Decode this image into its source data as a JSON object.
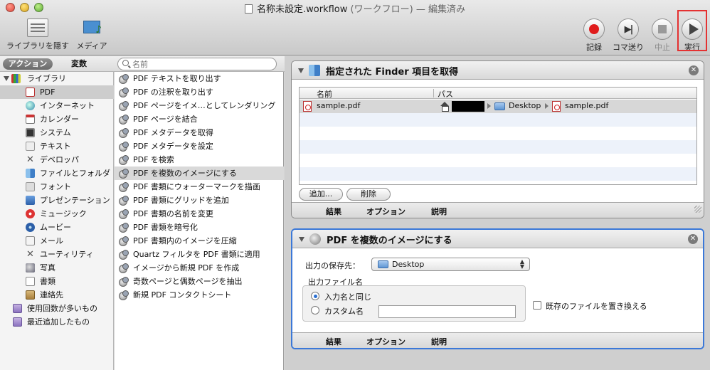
{
  "window": {
    "title": "名称未設定.workflow",
    "subtitle": "(ワークフロー) — 編集済み"
  },
  "toolbar": {
    "hide_library": "ライブラリを隠す",
    "media": "メディア",
    "record": "記録",
    "step": "コマ送り",
    "stop": "中止",
    "run": "実行"
  },
  "library_header": {
    "actions_tab": "アクション",
    "variables_tab": "変数",
    "search_placeholder": "名前"
  },
  "categories": [
    {
      "label": "ライブラリ",
      "icon": "library-icon"
    },
    {
      "label": "PDF",
      "icon": "pdf-icon",
      "selected": true
    },
    {
      "label": "インターネット",
      "icon": "globe-icon"
    },
    {
      "label": "カレンダー",
      "icon": "calendar-icon"
    },
    {
      "label": "システム",
      "icon": "system-icon"
    },
    {
      "label": "テキスト",
      "icon": "text-icon"
    },
    {
      "label": "デベロッパ",
      "icon": "developer-icon"
    },
    {
      "label": "ファイルとフォルダ",
      "icon": "finder-icon"
    },
    {
      "label": "フォント",
      "icon": "font-icon"
    },
    {
      "label": "プレゼンテーション",
      "icon": "presentation-icon"
    },
    {
      "label": "ミュージック",
      "icon": "music-icon"
    },
    {
      "label": "ムービー",
      "icon": "movie-icon"
    },
    {
      "label": "メール",
      "icon": "mail-icon"
    },
    {
      "label": "ユーティリティ",
      "icon": "utility-icon"
    },
    {
      "label": "写真",
      "icon": "photo-icon"
    },
    {
      "label": "書類",
      "icon": "document-icon"
    },
    {
      "label": "連絡先",
      "icon": "contacts-icon"
    },
    {
      "label": "使用回数が多いもの",
      "icon": "smart-folder-icon"
    },
    {
      "label": "最近追加したもの",
      "icon": "smart-folder-icon"
    }
  ],
  "actions": [
    {
      "label": "PDF テキストを取り出す"
    },
    {
      "label": "PDF の注釈を取り出す"
    },
    {
      "label": "PDF ページをイメ…としてレンダリング"
    },
    {
      "label": "PDF ページを結合"
    },
    {
      "label": "PDF メタデータを取得"
    },
    {
      "label": "PDF メタデータを設定"
    },
    {
      "label": "PDF を検索"
    },
    {
      "label": "PDF を複数のイメージにする",
      "selected": true
    },
    {
      "label": "PDF 書類にウォーターマークを描画"
    },
    {
      "label": "PDF 書類にグリッドを追加"
    },
    {
      "label": "PDF 書類の名前を変更"
    },
    {
      "label": "PDF 書類を暗号化"
    },
    {
      "label": "PDF 書類内のイメージを圧縮"
    },
    {
      "label": "Quartz フィルタを PDF 書類に適用"
    },
    {
      "label": "イメージから新規 PDF を作成"
    },
    {
      "label": "奇数ページと偶数ページを抽出"
    },
    {
      "label": "新規 PDF コンタクトシート"
    }
  ],
  "step1": {
    "title": "指定された Finder 項目を取得",
    "columns": [
      "名前",
      "パス"
    ],
    "file": {
      "name": "sample.pdf",
      "path_folder": "Desktop",
      "path_file": "sample.pdf"
    },
    "add_button": "追加...",
    "delete_button": "削除",
    "footer": [
      "結果",
      "オプション",
      "説明"
    ]
  },
  "step2": {
    "title": "PDF を複数のイメージにする",
    "save_to_label": "出力の保存先：",
    "save_to_value": "Desktop",
    "filename_group": "出力ファイル名",
    "radio_same": "入力名と同じ",
    "radio_custom": "カスタム名",
    "custom_name_value": "",
    "replace_existing": "既存のファイルを置き換える",
    "footer": [
      "結果",
      "オプション",
      "説明"
    ]
  },
  "colors": {
    "selection_border": "#3b78d8",
    "run_highlight": "#e43131",
    "record_red": "#e01c1c"
  }
}
